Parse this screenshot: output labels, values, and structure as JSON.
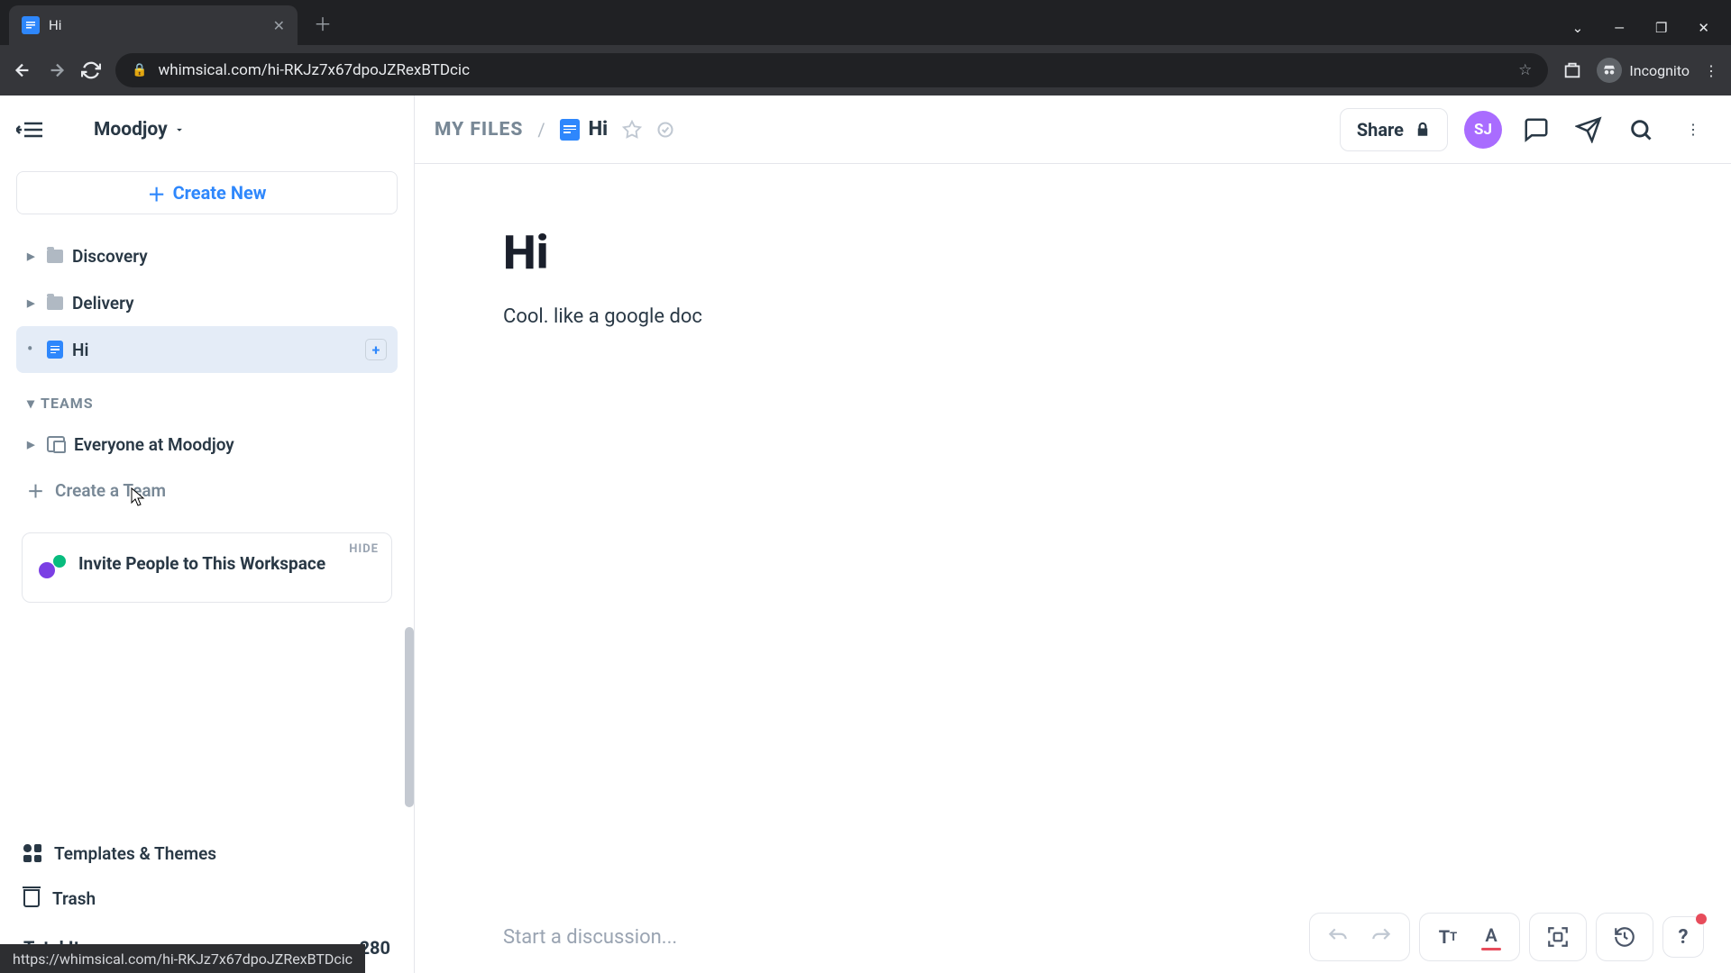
{
  "browser": {
    "tab_title": "Hi",
    "url_display": "whimsical.com/hi-RKJz7x67dpoJZRexBTDcic",
    "incognito_label": "Incognito",
    "status_url": "https://whimsical.com/hi-RKJz7x67dpoJZRexBTDcic"
  },
  "sidebar": {
    "workspace": "Moodjoy",
    "create_label": "Create New",
    "items": [
      {
        "label": "Discovery"
      },
      {
        "label": "Delivery"
      },
      {
        "label": "Hi"
      }
    ],
    "teams_header": "TEAMS",
    "teams": [
      {
        "label": "Everyone at Moodjoy"
      }
    ],
    "create_team_label": "Create a Team",
    "invite": {
      "hide": "HIDE",
      "text": "Invite People to This Workspace"
    },
    "footer": {
      "templates": "Templates & Themes",
      "trash": "Trash",
      "total_label": "Total Items",
      "total_value": "280"
    }
  },
  "header": {
    "breadcrumb_root": "MY FILES",
    "breadcrumb_current": "Hi",
    "share": "Share",
    "avatar": "SJ"
  },
  "document": {
    "title": "Hi",
    "body": "Cool. like a google doc"
  },
  "bottom": {
    "discussion_placeholder": "Start a discussion..."
  }
}
